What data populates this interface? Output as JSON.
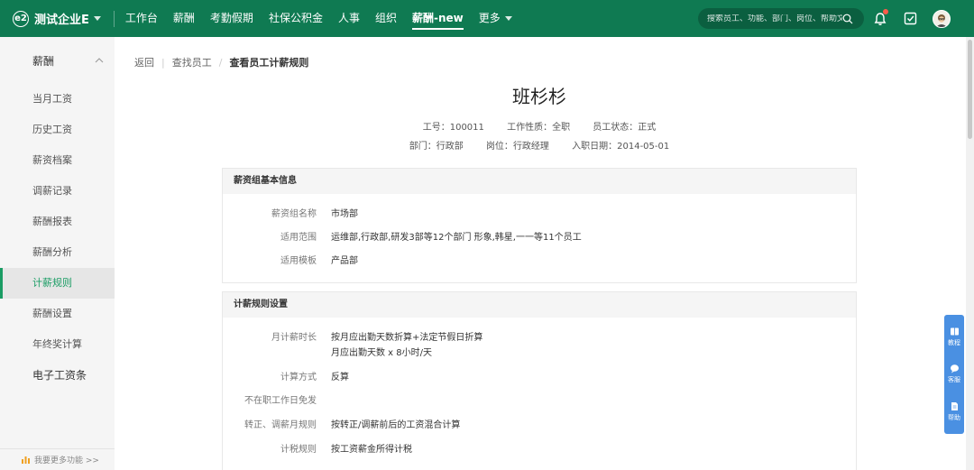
{
  "brand": {
    "name": "测试企业E"
  },
  "nav": [
    {
      "label": "工作台",
      "active": false
    },
    {
      "label": "薪酬",
      "active": false
    },
    {
      "label": "考勤假期",
      "active": false
    },
    {
      "label": "社保公积金",
      "active": false
    },
    {
      "label": "人事",
      "active": false
    },
    {
      "label": "组织",
      "active": false
    },
    {
      "label": "薪酬-new",
      "active": true
    },
    {
      "label": "更多",
      "active": false
    }
  ],
  "search": {
    "placeholder": "搜索员工、功能、部门、岗位、帮助文档"
  },
  "sidebar": {
    "group": "薪酬",
    "items": [
      "当月工资",
      "历史工资",
      "薪资档案",
      "调薪记录",
      "薪酬报表",
      "薪酬分析",
      "计薪规则",
      "薪酬设置",
      "年终奖计算",
      "电子工资条"
    ],
    "active_index": 6,
    "footer": "我要更多功能 >>"
  },
  "breadcrumb": {
    "back": "返回",
    "level1": "查找员工",
    "current": "查看员工计薪规则"
  },
  "employee": {
    "name": "班杉杉",
    "id_label": "工号：",
    "id": "100011",
    "type_label": "工作性质：",
    "type": "全职",
    "status_label": "员工状态：",
    "status": "正式",
    "dept_label": "部门：",
    "dept": "行政部",
    "post_label": "岗位：",
    "post": "行政经理",
    "join_label": "入职日期：",
    "join": "2014-05-01"
  },
  "basic": {
    "title": "薪资组基本信息",
    "rows": [
      {
        "label": "薪资组名称",
        "value": "市场部"
      },
      {
        "label": "适用范围",
        "value": "运维部,行政部,研发3部等12个部门 形象,韩星,一一等11个员工"
      },
      {
        "label": "适用模板",
        "value": "产品部"
      }
    ]
  },
  "rules": {
    "title": "计薪规则设置",
    "rows": [
      {
        "label": "月计薪时长",
        "value": "按月应出勤天数折算+法定节假日折算",
        "value2": "月应出勤天数 x 8小时/天"
      },
      {
        "label": "计算方式",
        "value": "反算"
      },
      {
        "label": "不在职工作日免发",
        "value": ""
      },
      {
        "label": "转正、调薪月规则",
        "value": "按转正/调薪前后的工资混合计算"
      },
      {
        "label": "计税规则",
        "value": "按工资薪金所得计税"
      }
    ]
  },
  "float_help": [
    "教程",
    "客服",
    "帮助"
  ],
  "colors": {
    "topbar": "#0f7a52",
    "accent": "#1a9c64",
    "float": "#4a90e2"
  }
}
